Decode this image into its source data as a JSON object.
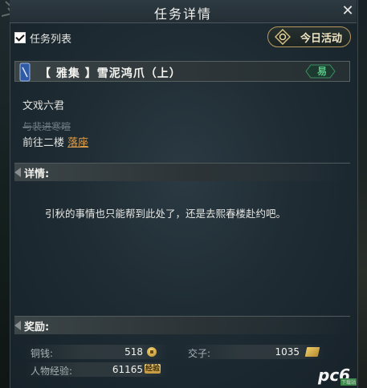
{
  "window": {
    "title": "任务详情"
  },
  "toolbar": {
    "task_list_label": "任务列表",
    "task_list_checked": true,
    "today_activity_label": "今日活动"
  },
  "quest": {
    "title": "【 雅集 】雪泥鸿爪（上）",
    "difficulty": "易",
    "npc": "文戏六君",
    "completed_step": "与裴进寒暄",
    "current_step_prefix": "前往二楼 ",
    "current_step_link": "落座"
  },
  "details": {
    "heading": "详情:",
    "text": "引秋的事情也只能帮到此处了，还是去熙春楼赴约吧。"
  },
  "rewards": {
    "heading": "奖励:",
    "copper_label": "铜钱:",
    "copper_value": "518",
    "exp_label": "人物经验:",
    "exp_value": "61165",
    "exp_tag": "经验",
    "jiaozi_label": "交子:",
    "jiaozi_value": "1035"
  },
  "watermark": {
    "text": "pc6",
    "small": "下载站"
  },
  "colors": {
    "link": "#e3a04a",
    "difficulty": "#59c784",
    "accent_gold": "#b99a5e"
  }
}
